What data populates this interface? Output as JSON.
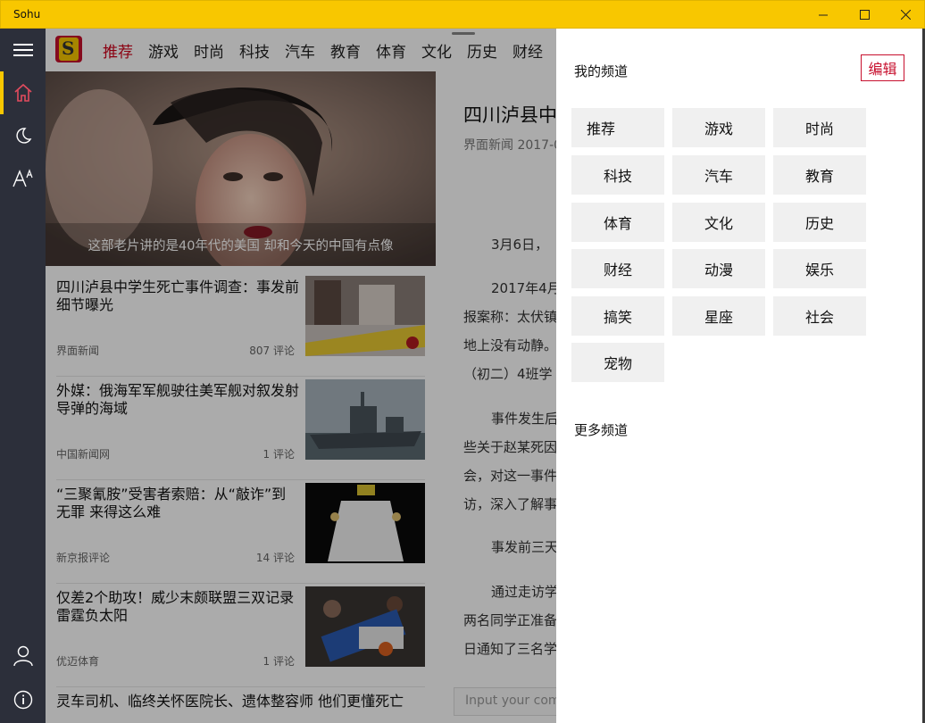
{
  "window": {
    "title": "Sohu"
  },
  "sidebar": {
    "items": [
      "menu-icon",
      "home-icon",
      "night-mode-icon",
      "font-size-icon",
      "user-icon",
      "info-icon"
    ]
  },
  "topnav": {
    "tabs": [
      "推荐",
      "游戏",
      "时尚",
      "科技",
      "汽车",
      "教育",
      "体育",
      "文化",
      "历史",
      "财经"
    ],
    "active": "推荐"
  },
  "hero": {
    "caption": "这部老片讲的是40年代的美国 却和今天的中国有点像"
  },
  "articles": [
    {
      "title": "四川泸县中学生死亡事件调查：事发前细节曝光",
      "source": "界面新闻",
      "comments": "807 评论"
    },
    {
      "title": "外媒：俄海军军舰驶往美军舰对叙发射导弹的海域",
      "source": "中国新闻网",
      "comments": "1 评论"
    },
    {
      "title": "“三聚氰胺”受害者索赔：从“敲诈”到无罪 来得这么难",
      "source": "新京报评论",
      "comments": "14 评论"
    },
    {
      "title": "仅差2个助攻！威少末颇联盟三双记录 雷霆负太阳",
      "source": "优迈体育",
      "comments": "1 评论"
    }
  ],
  "last_article_title": "灵车司机、临终关怀医院长、遗体整容师 他们更懂死亡",
  "detail": {
    "title": "四川泸县中",
    "meta": "界面新闻 2017-0",
    "paragraphs": [
      "3月6日，",
      "2017年4月",
      "报案称：太伏镇",
      "地上没有动静。",
      "（初二）4班学",
      "事件发生后",
      "些关于赵某死因",
      "会，对这一事件",
      "访，深入了解事",
      "事发前三天",
      "通过走访学",
      "两名同学正准备",
      "日通知了三名学"
    ],
    "comment_placeholder": "Input your comm"
  },
  "channel_panel": {
    "heading": "我的频道",
    "edit_label": "编辑",
    "channels": [
      "推荐",
      "游戏",
      "时尚",
      "科技",
      "汽车",
      "教育",
      "体育",
      "文化",
      "历史",
      "财经",
      "动漫",
      "娱乐",
      "搞笑",
      "星座",
      "社会",
      "宠物"
    ],
    "more_label": "更多频道"
  },
  "colors": {
    "accent": "#f8c700",
    "brand_red": "#c7102e",
    "sidebar": "#2c2f3a"
  }
}
